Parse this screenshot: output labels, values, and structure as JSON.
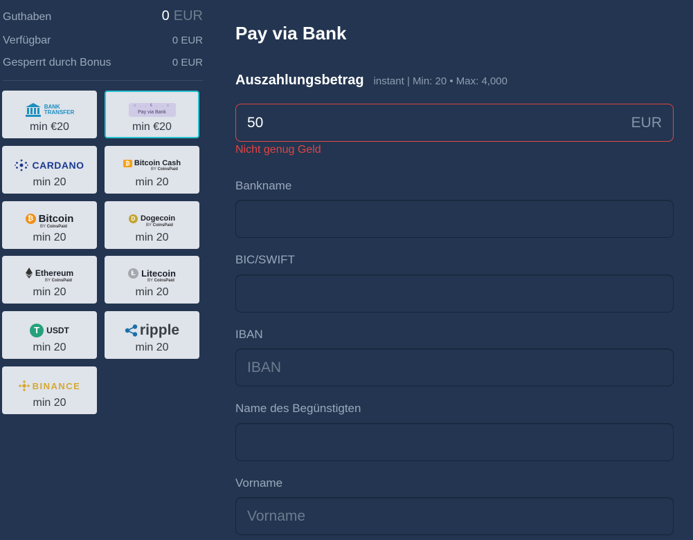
{
  "balance": {
    "guthaben_label": "Guthaben",
    "guthaben_value": "0",
    "guthaben_currency": "EUR",
    "verfuegbar_label": "Verfügbar",
    "verfuegbar_value": "0 EUR",
    "gesperrt_label": "Gesperrt durch Bonus",
    "gesperrt_value": "0 EUR"
  },
  "methods": [
    {
      "name": "bank-transfer",
      "logo_lines": [
        "BANK",
        "TRANSFER"
      ],
      "min": "min €20",
      "selected": false
    },
    {
      "name": "pay-via-bank",
      "logo_lines": [
        "Pay via Bank"
      ],
      "min": "min €20",
      "selected": true
    },
    {
      "name": "cardano",
      "logo_lines": [
        "CARDANO"
      ],
      "min": "min 20",
      "selected": false
    },
    {
      "name": "bitcoin-cash",
      "logo_lines": [
        "Bitcoin Cash",
        "CoinsPaid"
      ],
      "min": "min 20",
      "selected": false
    },
    {
      "name": "bitcoin",
      "logo_lines": [
        "Bitcoin",
        "CoinsPaid"
      ],
      "min": "min 20",
      "selected": false
    },
    {
      "name": "dogecoin",
      "logo_lines": [
        "Dogecoin",
        "CoinsPaid"
      ],
      "min": "min 20",
      "selected": false
    },
    {
      "name": "ethereum",
      "logo_lines": [
        "Ethereum",
        "CoinsPaid"
      ],
      "min": "min 20",
      "selected": false
    },
    {
      "name": "litecoin",
      "logo_lines": [
        "Litecoin",
        "CoinsPaid"
      ],
      "min": "min 20",
      "selected": false
    },
    {
      "name": "usdt",
      "logo_lines": [
        "USDT"
      ],
      "min": "min 20",
      "selected": false
    },
    {
      "name": "ripple",
      "logo_lines": [
        "ripple"
      ],
      "min": "min 20",
      "selected": false
    },
    {
      "name": "binance",
      "logo_lines": [
        "BINANCE"
      ],
      "min": "min 20",
      "selected": false
    }
  ],
  "form": {
    "title": "Pay via Bank",
    "amount_heading": "Auszahlungsbetrag",
    "amount_limits": "instant | Min: 20 • Max: 4,000",
    "amount_value": "50",
    "amount_currency": "EUR",
    "amount_error": "Nicht genug Geld",
    "bankname_label": "Bankname",
    "bankname_value": "",
    "bic_label": "BIC/SWIFT",
    "bic_value": "",
    "iban_label": "IBAN",
    "iban_placeholder": "IBAN",
    "beneficiary_label": "Name des Begünstigten",
    "beneficiary_value": "",
    "firstname_label": "Vorname",
    "firstname_placeholder": "Vorname"
  },
  "colors": {
    "background": "#233550",
    "selected_border": "#27c0d0",
    "error": "#e04545",
    "tile_bg": "#dfe3ea"
  },
  "by_label": "BY"
}
